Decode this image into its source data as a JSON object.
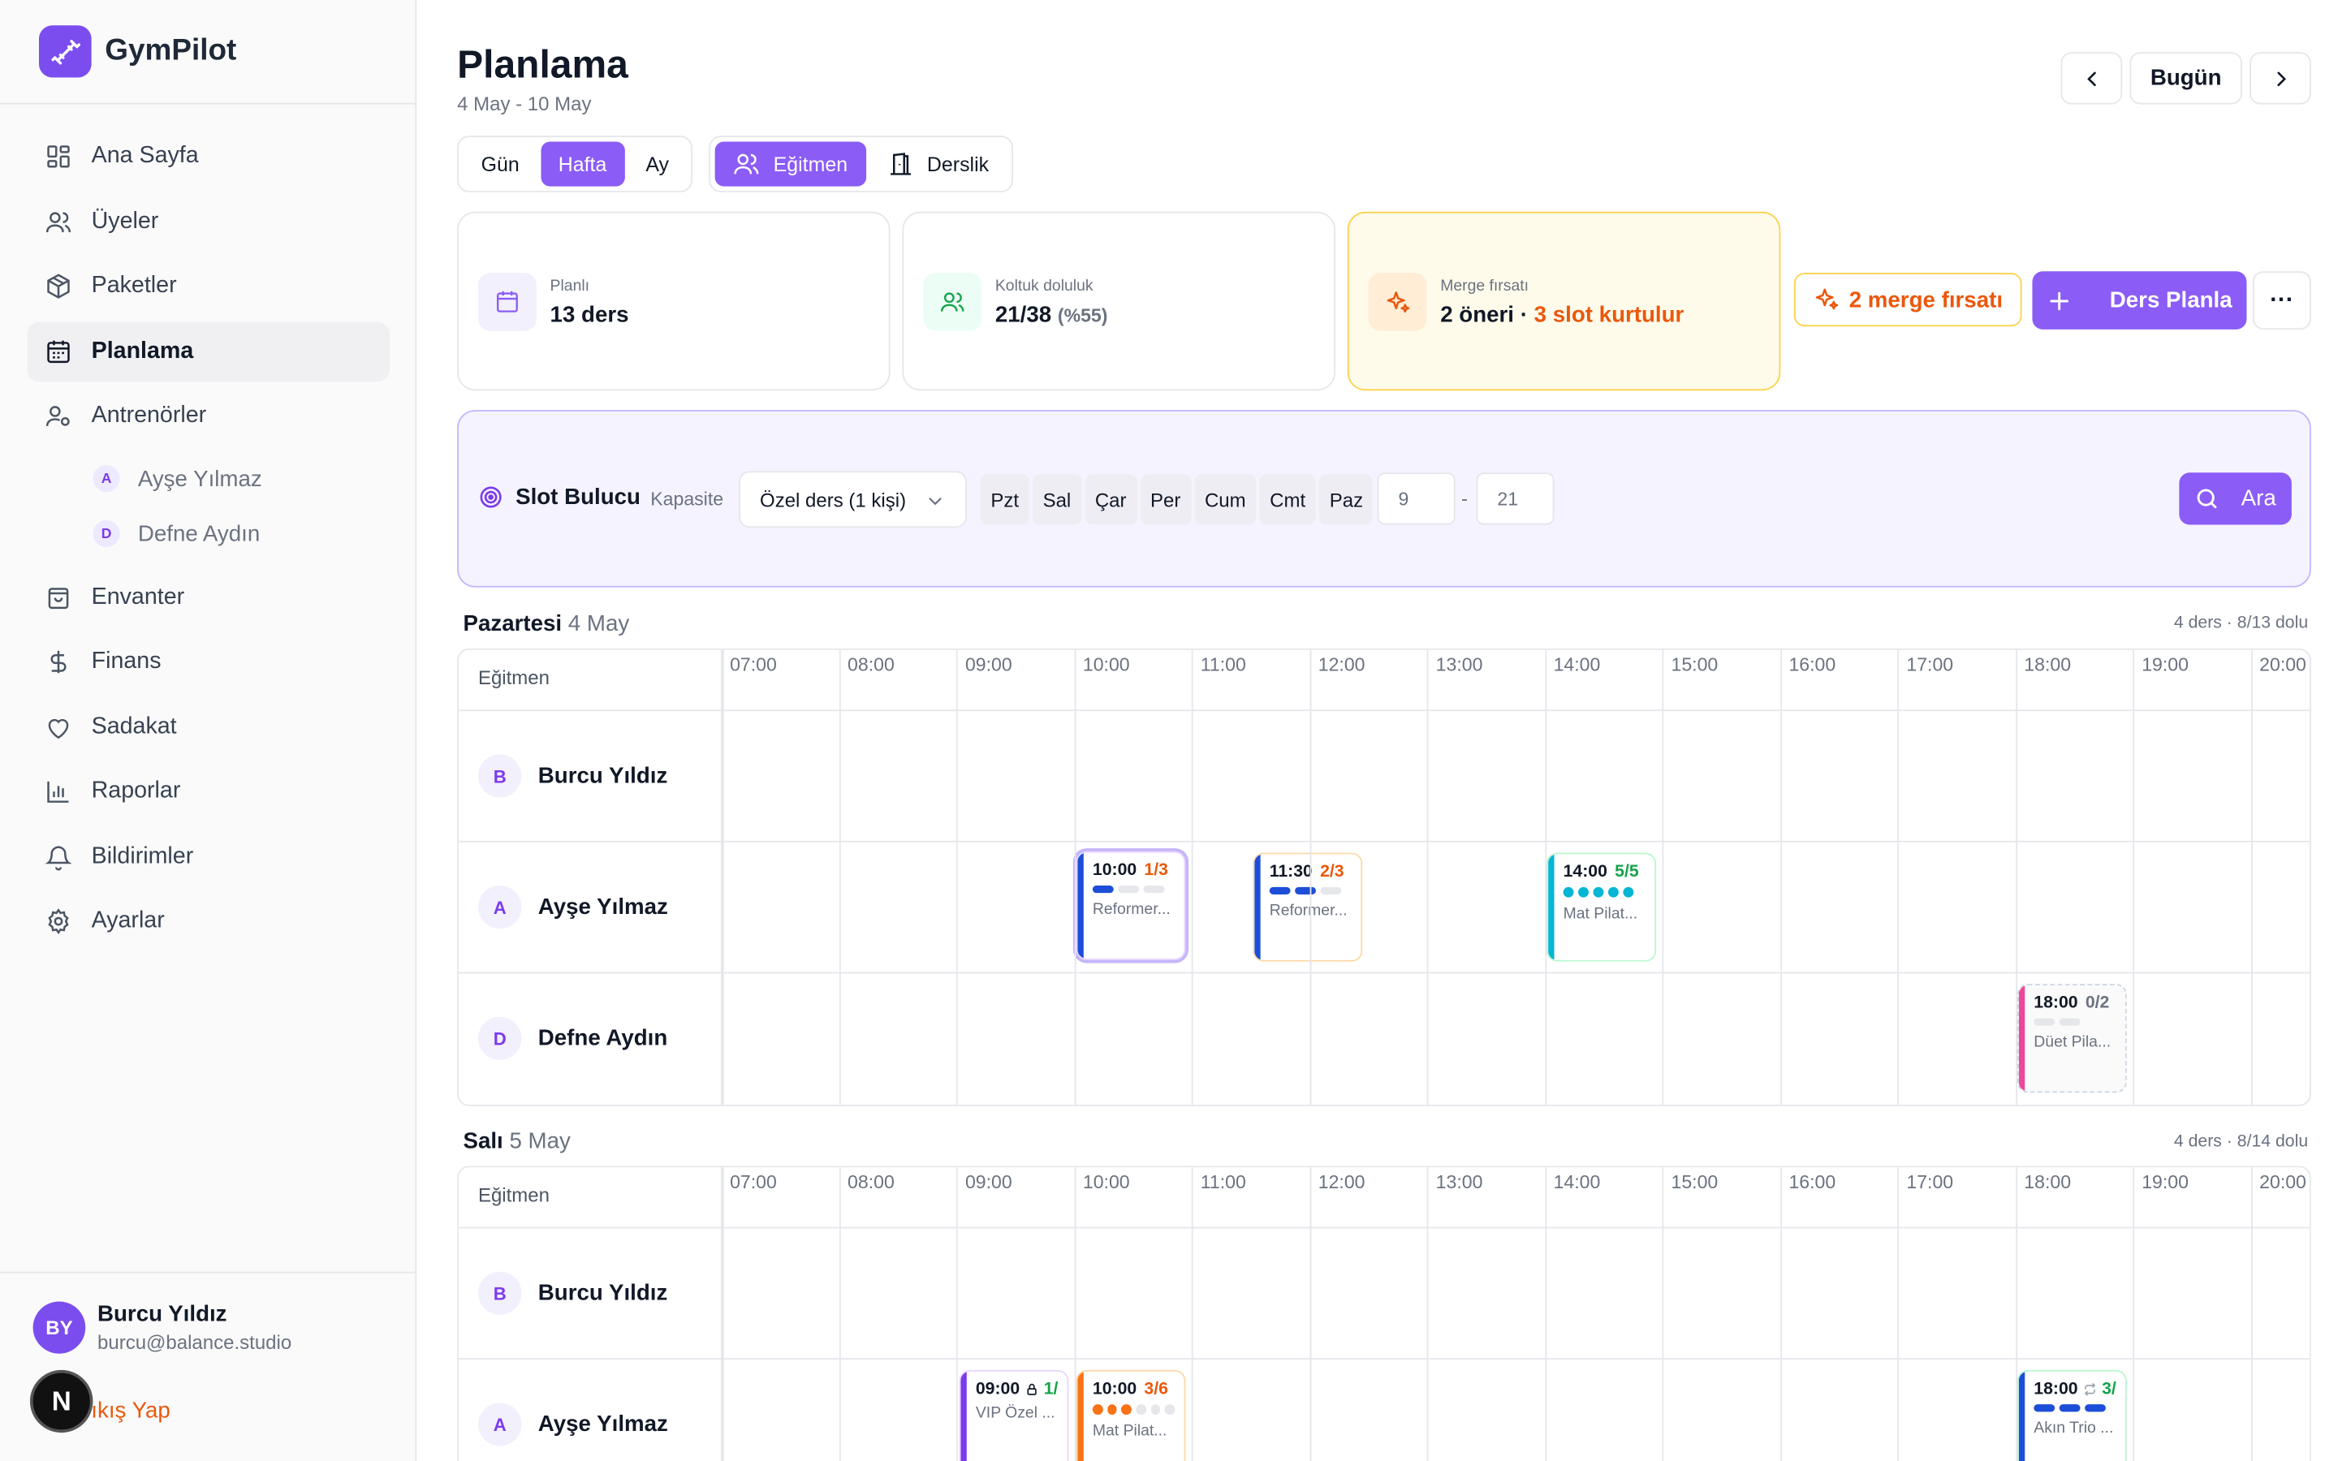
{
  "app": {
    "name": "GymPilot"
  },
  "sidebar": {
    "items": [
      {
        "label": "Ana Sayfa",
        "icon": "grid-icon"
      },
      {
        "label": "Üyeler",
        "icon": "users-icon"
      },
      {
        "label": "Paketler",
        "icon": "package-icon"
      },
      {
        "label": "Planlama",
        "icon": "calendar-icon",
        "active": true
      },
      {
        "label": "Antrenörler",
        "icon": "trainer-icon"
      },
      {
        "label": "Envanter",
        "icon": "bag-icon"
      },
      {
        "label": "Finans",
        "icon": "dollar-icon"
      },
      {
        "label": "Sadakat",
        "icon": "heart-icon"
      },
      {
        "label": "Raporlar",
        "icon": "chart-icon"
      },
      {
        "label": "Bildirimler",
        "icon": "bell-icon"
      },
      {
        "label": "Ayarlar",
        "icon": "gear-icon"
      }
    ],
    "trainers": [
      {
        "initial": "A",
        "name": "Ayşe Yılmaz"
      },
      {
        "initial": "D",
        "name": "Defne Aydın"
      }
    ],
    "user": {
      "initials": "BY",
      "name": "Burcu Yıldız",
      "email": "burcu@balance.studio"
    },
    "logout": "Çıkış Yap",
    "badge": "N"
  },
  "header": {
    "title": "Planlama",
    "range": "4 May - 10 May",
    "today": "Bugün"
  },
  "view_toggle": {
    "day": "Gün",
    "week": "Hafta",
    "month": "Ay"
  },
  "mode_toggle": {
    "trainer": "Eğitmen",
    "room": "Derslik"
  },
  "stats": {
    "planned": {
      "label": "Planlı",
      "value": "13 ders"
    },
    "occupancy": {
      "label": "Koltuk doluluk",
      "value": "21/38",
      "pct": "(%55)"
    },
    "merge": {
      "label": "Merge fırsatı",
      "value": "2 öneri",
      "sep": " · ",
      "highlight": "3 slot kurtulur"
    }
  },
  "actions": {
    "merge": "2 merge fırsatı",
    "plan": "Ders Planla",
    "more": "···"
  },
  "slot_finder": {
    "title": "Slot Bulucu",
    "capacity_label": "Kapasite",
    "capacity_value": "Özel ders (1 kişi)",
    "days": [
      "Pzt",
      "Sal",
      "Çar",
      "Per",
      "Cum",
      "Cmt",
      "Paz"
    ],
    "from": "9",
    "sep": "-",
    "to": "21",
    "search": "Ara"
  },
  "hours": [
    "07:00",
    "08:00",
    "09:00",
    "10:00",
    "11:00",
    "12:00",
    "13:00",
    "14:00",
    "15:00",
    "16:00",
    "17:00",
    "18:00",
    "19:00",
    "20:00"
  ],
  "grid_header": "Eğitmen",
  "days": [
    {
      "name": "Pazartesi",
      "date": "4 May",
      "summary": "4 ders · 8/13 dolu",
      "rows": [
        {
          "initial": "B",
          "name": "Burcu Yıldız"
        },
        {
          "initial": "A",
          "name": "Ayşe Yılmaz"
        },
        {
          "initial": "D",
          "name": "Defne Aydın"
        }
      ]
    },
    {
      "name": "Salı",
      "date": "5 May",
      "summary": "4 ders · 8/14 dolu",
      "rows": [
        {
          "initial": "B",
          "name": "Burcu Yıldız"
        },
        {
          "initial": "A",
          "name": "Ayşe Yılmaz"
        }
      ]
    }
  ],
  "classes": {
    "mon_1000": {
      "time": "10:00",
      "cap": "1/3",
      "name": "Reformer..."
    },
    "mon_1130": {
      "time": "11:30",
      "cap": "2/3",
      "name": "Reformer..."
    },
    "mon_1400": {
      "time": "14:00",
      "cap": "5/5",
      "name": "Mat Pilat..."
    },
    "mon_1800": {
      "time": "18:00",
      "cap": "0/2",
      "name": "Düet Pila..."
    },
    "tue_0900": {
      "time": "09:00",
      "cap": "1/",
      "name": "VIP Özel ..."
    },
    "tue_1000": {
      "time": "10:00",
      "cap": "3/6",
      "name": "Mat Pilat..."
    },
    "tue_1800": {
      "time": "18:00",
      "cap": "3/",
      "name": "Akın Trio ..."
    }
  },
  "colors": {
    "brand": "#7c4dee",
    "accent": "#8b5cf6",
    "orange": "#ea580c",
    "blue": "#1d4ed8",
    "teal": "#06b6d4",
    "pink": "#ec4899",
    "green": "#16a34a"
  }
}
